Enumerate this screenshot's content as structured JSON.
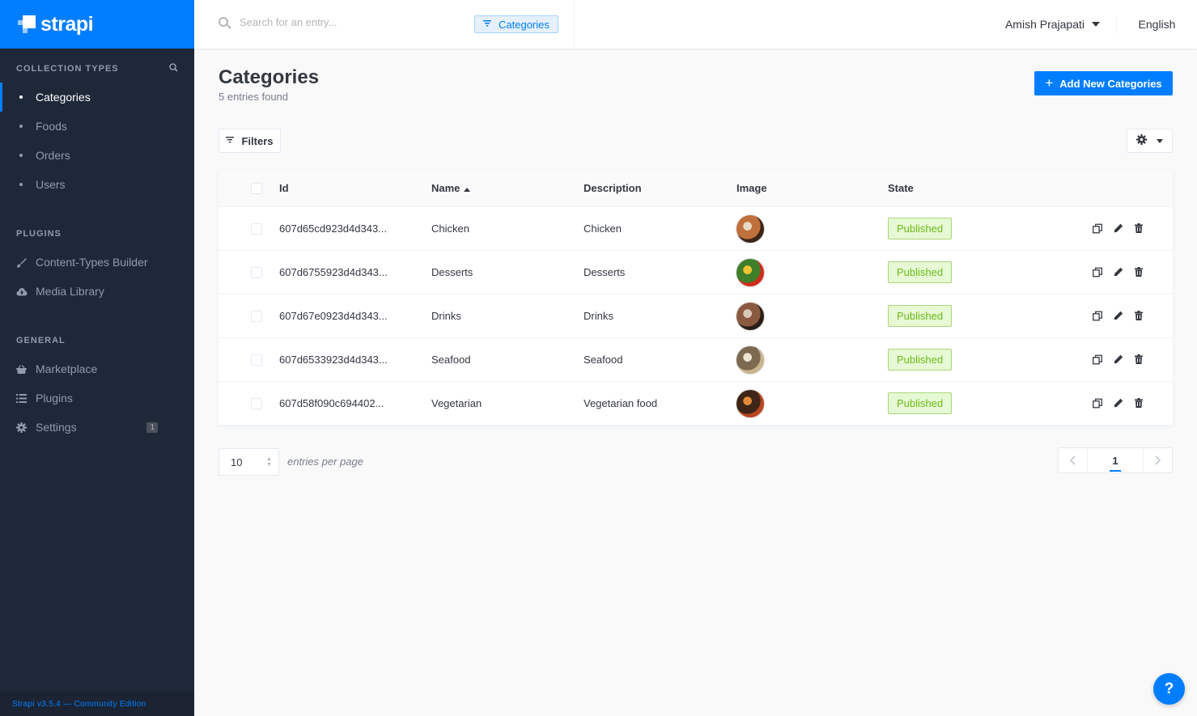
{
  "brand": {
    "name": "strapi"
  },
  "sidebar": {
    "collection_types": {
      "title": "COLLECTION TYPES",
      "items": [
        {
          "label": "Categories",
          "active": true
        },
        {
          "label": "Foods",
          "active": false
        },
        {
          "label": "Orders",
          "active": false
        },
        {
          "label": "Users",
          "active": false
        }
      ]
    },
    "plugins": {
      "title": "PLUGINS",
      "items": [
        {
          "label": "Content-Types Builder",
          "icon": "paintbrush-icon"
        },
        {
          "label": "Media Library",
          "icon": "cloud-upload-icon"
        }
      ]
    },
    "general": {
      "title": "GENERAL",
      "items": [
        {
          "label": "Marketplace",
          "icon": "shopping-basket-icon"
        },
        {
          "label": "Plugins",
          "icon": "list-icon"
        },
        {
          "label": "Settings",
          "icon": "gear-icon",
          "badge": "1"
        }
      ]
    },
    "footer": "Strapi v3.5.4 — Community Edition"
  },
  "topbar": {
    "search_placeholder": "Search for an entry...",
    "search_tag": "Categories",
    "user": "Amish Prajapati",
    "language": "English"
  },
  "page": {
    "title": "Categories",
    "subtitle": "5 entries found",
    "add_button": "Add New Categories",
    "filters_button": "Filters"
  },
  "table": {
    "headers": {
      "id": "Id",
      "name": "Name",
      "description": "Description",
      "image": "Image",
      "state": "State"
    },
    "rows": [
      {
        "id": "607d65cd923d4d343...",
        "name": "Chicken",
        "description": "Chicken",
        "state": "Published",
        "image_colors": [
          "#3b2418",
          "#c0703c",
          "#e8d9c4"
        ]
      },
      {
        "id": "607d6755923d4d343...",
        "name": "Desserts",
        "description": "Desserts",
        "state": "Published",
        "image_colors": [
          "#d12b1b",
          "#3f7f2a",
          "#f4c430"
        ]
      },
      {
        "id": "607d67e0923d4d343...",
        "name": "Drinks",
        "description": "Drinks",
        "state": "Published",
        "image_colors": [
          "#2b1e18",
          "#8a5a40",
          "#d9c7b8"
        ]
      },
      {
        "id": "607d6533923d4d343...",
        "name": "Seafood",
        "description": "Seafood",
        "state": "Published",
        "image_colors": [
          "#c9b48e",
          "#7b6a50",
          "#efe5d3"
        ]
      },
      {
        "id": "607d58f090c694402...",
        "name": "Vegetarian",
        "description": "Vegetarian food",
        "state": "Published",
        "image_colors": [
          "#b8461f",
          "#3d2618",
          "#e38a3a"
        ]
      }
    ]
  },
  "pagination": {
    "per_page": "10",
    "per_page_label": "entries per page",
    "current_page": "1"
  },
  "help": {
    "label": "?"
  },
  "colors": {
    "accent": "#007eff",
    "sidebar": "#1f2839",
    "published_bg": "#e6f8d4",
    "published_text": "#6dbb1a"
  }
}
